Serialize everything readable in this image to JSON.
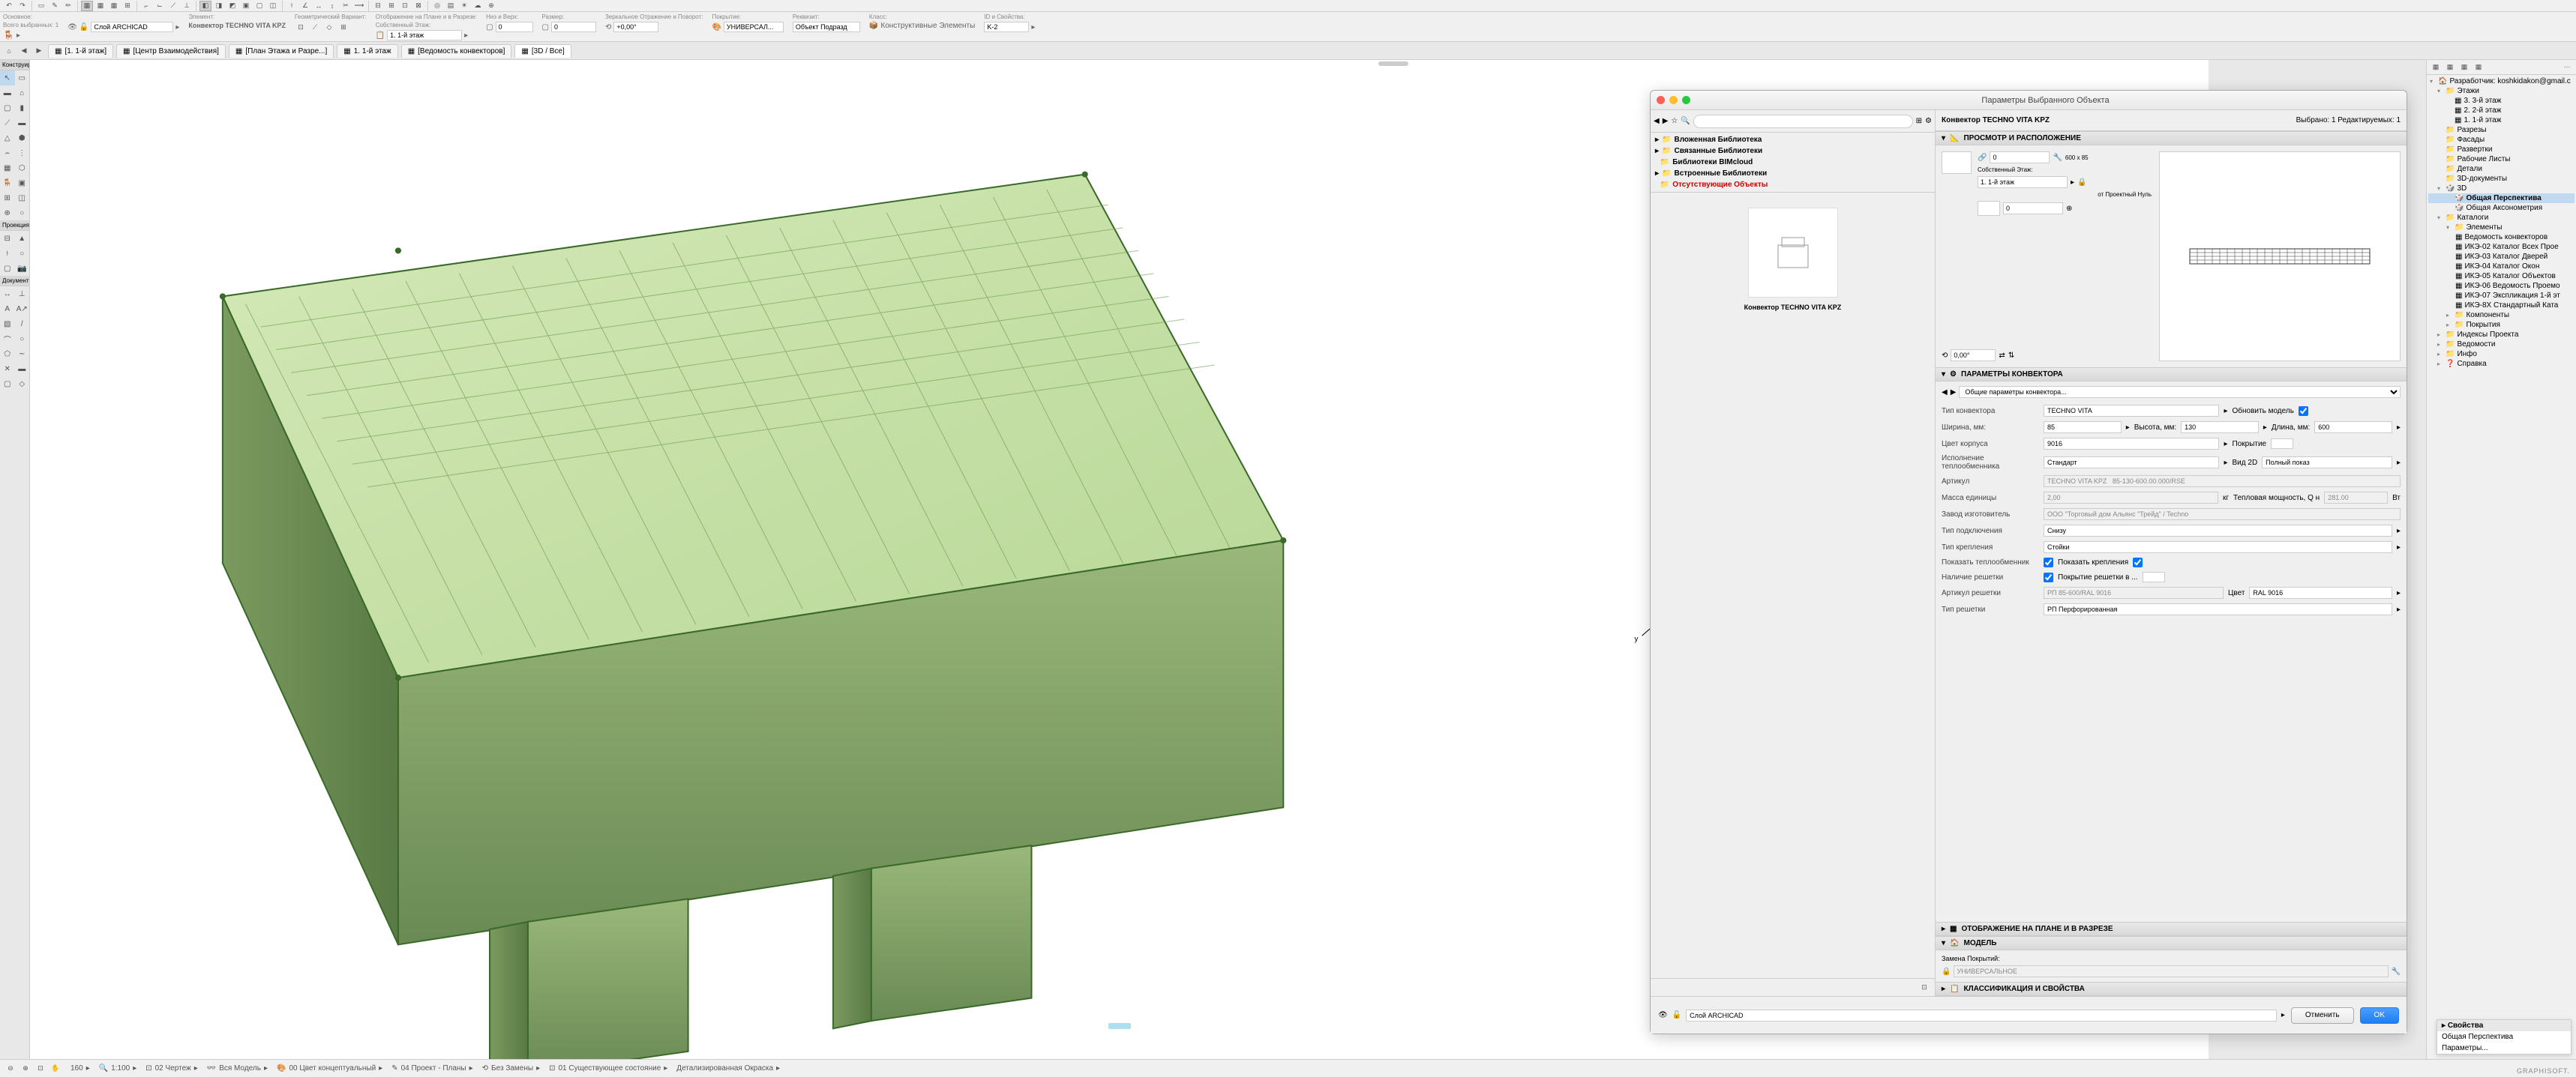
{
  "app": {
    "selected_count_label": "Всего выбранных: 1",
    "element_label": "Элемент:",
    "element_name": "Конвектор TECHNO VITA KPZ"
  },
  "toolbar_labels": {
    "osnovnoe": "Основное:",
    "geom_variant": "Геометрический Вариант:",
    "display_plan": "Отображение на Плане и в Разрезе:",
    "niz_verkh": "Низ и Верх:",
    "razmer": "Размер:",
    "mirror_rotate": "Зеркальное Отражение и Поворот:",
    "pokrytie": "Покрытие:",
    "relatsii": "Реквизит:",
    "klass": "Класс:",
    "id_svoystva": "ID и Свойства:"
  },
  "infobar": {
    "layer_label": "Слой ARCHICAD",
    "floor_label": "Собственный Этаж:",
    "floor_value": "1. 1-й этаж",
    "size_val": "0",
    "angle_val": "+0,00°",
    "pokrytie_val": "УНИВЕРСАЛ...",
    "rekvizit_val": "Объект Подразд",
    "klass_val": "Конструктивные Элементы",
    "id_val": "K-2"
  },
  "tabs": [
    "[1. 1-й этаж]",
    "[Центр Взаимодействия]",
    "[План Этажа и Разре...]",
    "1. 1-й этаж",
    "[Ведомость конвекторов]",
    "[3D / Все]"
  ],
  "toolbox": {
    "header1": "Конструиров",
    "header2": "Проекция",
    "header3": "Документиров"
  },
  "dialog": {
    "title": "Параметры Выбранного Объекта",
    "object_name": "Конвектор TECHNO VITA KPZ",
    "selected_info": "Выбрано: 1 Редактируемых: 1",
    "libs": {
      "embedded": "Вложенная Библиотека",
      "linked": "Связанные Библиотеки",
      "bimcloud": "Библиотеки BIMcloud",
      "builtin": "Встроенные Библиотеки",
      "missing": "Отсутствующие Объекты"
    },
    "preview_name": "Конвектор TECHNO VITA KPZ",
    "section_preview": "ПРОСМОТР И РАСПОЛОЖЕНИЕ",
    "section_params": "ПАРАМЕТРЫ КОНВЕКТОРА",
    "section_display": "ОТОБРАЖЕНИЕ НА ПЛАНЕ И В РАЗРЕЗЕ",
    "section_model": "МОДЕЛЬ",
    "section_class": "КЛАССИФИКАЦИЯ И СВОЙСТВА",
    "dropdown_general": "Общие параметры конвектора...",
    "pos_field1": "0",
    "own_floor_label": "Собственный Этаж:",
    "own_floor_val": "1. 1-й этаж",
    "from_zero_label": "от Проектный Нуль",
    "from_zero_val": "0",
    "dim_text": "600 х 85",
    "angle_val": "0,00°",
    "params": {
      "type_label": "Тип конвектора",
      "type_val": "TECHNO VITA",
      "update_label": "Обновить модель",
      "width_label": "Ширина, мм:",
      "width_val": "85",
      "height_label": "Высота, мм:",
      "height_val": "130",
      "length_label": "Длина, мм:",
      "length_val": "600",
      "body_color_label": "Цвет корпуса",
      "body_color_val": "9016",
      "coating_label": "Покрытие",
      "exec_label": "Исполнение теплообменника",
      "exec_val": "Стандарт",
      "view2d_label": "Вид 2D",
      "view2d_val": "Полный показ",
      "article_label": "Артикул",
      "article_val": "TECHNO VITA KPZ   85-130-600.00.000/RSE",
      "mass_label": "Масса единицы",
      "mass_val": "2,00",
      "mass_unit": "кг",
      "power_label": "Тепловая мощность, Q н",
      "power_val": "281.00",
      "power_unit": "Вт",
      "manufacturer_label": "Завод изготовитель",
      "manufacturer_val": "ООО \"Торговый дом Альянс \"Трейд\" / Techno",
      "conn_type_label": "Тип подключения",
      "conn_type_val": "Снизу",
      "mount_type_label": "Тип крепления",
      "mount_type_val": "Стойки",
      "show_heat_label": "Показать теплообменник",
      "show_mount_label": "Показать крепления",
      "has_grille_label": "Наличие решетки",
      "grille_coating_label": "Покрытие решетки в ...",
      "grille_article_label": "Артикул решетки",
      "grille_article_val": "РП 85-600/RAL 9016",
      "color_label": "Цвет",
      "color_val": "RAL 9016",
      "grille_type_label": "Тип решетки",
      "grille_type_val": "РП Перфорированная"
    },
    "replace_coatings_label": "Замена Покрытий:",
    "replace_coatings_val": "УНИВЕРСАЛЬНОЕ",
    "footer_layer": "Слой ARCHICAD",
    "btn_cancel": "Отменить",
    "btn_ok": "OK"
  },
  "navigator": {
    "root": "Разработчик: koshkidakon@gmail.c",
    "floors": "Этажи",
    "floor_items": [
      "3. 3-й этаж",
      "2. 2-й этаж",
      "1. 1-й этаж"
    ],
    "sections": "Разрезы",
    "facades": "Фасады",
    "razvertki": "Развертки",
    "sheets": "Рабочие Листы",
    "details": "Детали",
    "docs3d": "3D-документы",
    "view3d": "3D",
    "perspective": "Общая Перспектива",
    "axon": "Общая Аксонометрия",
    "catalogs": "Каталоги",
    "elements": "Элементы",
    "catalog_items": [
      "Ведомость конвекторов",
      "ИКЭ-02 Каталог Всех Прое",
      "ИКЭ-03 Каталог Дверей",
      "ИКЭ-04 Каталог Окон",
      "ИКЭ-05 Каталог Объектов",
      "ИКЭ-06 Ведомость Проемо",
      "ИКЭ-07 Экспликация 1-й эт",
      "ИКЭ-8X Стандартный Ката"
    ],
    "components": "Компоненты",
    "coatings": "Покрытия",
    "indexes": "Индексы Проекта",
    "lists": "Ведомости",
    "info": "Инфо",
    "help": "Справка"
  },
  "statusbar": {
    "scale": "1:100",
    "zoom": "160",
    "drawing": "02 Чертеж",
    "model": "Вся Модель",
    "color": "00 Цвет концептуальный",
    "project": "04 Проект - Планы",
    "replace": "Без Замены",
    "state": "01 Существующее состояние",
    "detail": "Детализированная Окраска"
  },
  "context_menu": {
    "header": "Свойства",
    "item1": "Общая Перспектива",
    "item2": "Параметры..."
  },
  "brand": "GRAPHISOFT."
}
